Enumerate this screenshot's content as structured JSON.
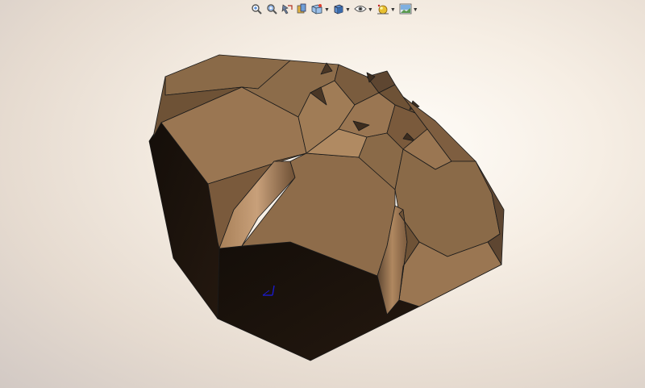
{
  "window": {
    "background_top": "#fffdf9",
    "background_bottom": "#d2c9c4"
  },
  "heads_up_toolbar": {
    "buttons": [
      {
        "name": "zoom-to-fit",
        "icon": "zoom-to-fit-icon",
        "dropdown": false
      },
      {
        "name": "zoom-to-area",
        "icon": "zoom-to-area-icon",
        "dropdown": false
      },
      {
        "name": "previous-view",
        "icon": "previous-view-icon",
        "dropdown": false
      },
      {
        "name": "section-view",
        "icon": "section-view-icon",
        "dropdown": false
      },
      {
        "name": "view-orientation",
        "icon": "view-orientation-icon",
        "dropdown": true
      },
      {
        "name": "display-style",
        "icon": "display-style-icon",
        "dropdown": true
      },
      {
        "name": "hide-show-items",
        "icon": "hide-show-items-icon",
        "dropdown": true
      },
      {
        "name": "edit-appearance",
        "icon": "edit-appearance-icon",
        "dropdown": true
      },
      {
        "name": "apply-scene",
        "icon": "apply-scene-icon",
        "dropdown": true
      }
    ]
  },
  "model": {
    "name": "faceted-solid-body",
    "color_light": "#9a7652",
    "color_mid": "#8a6a48",
    "color_dark": "#5e4631",
    "color_shadow": "#1c130d",
    "edge_color": "#1a1a1a"
  },
  "triad": {
    "color": "#1a1acc"
  }
}
